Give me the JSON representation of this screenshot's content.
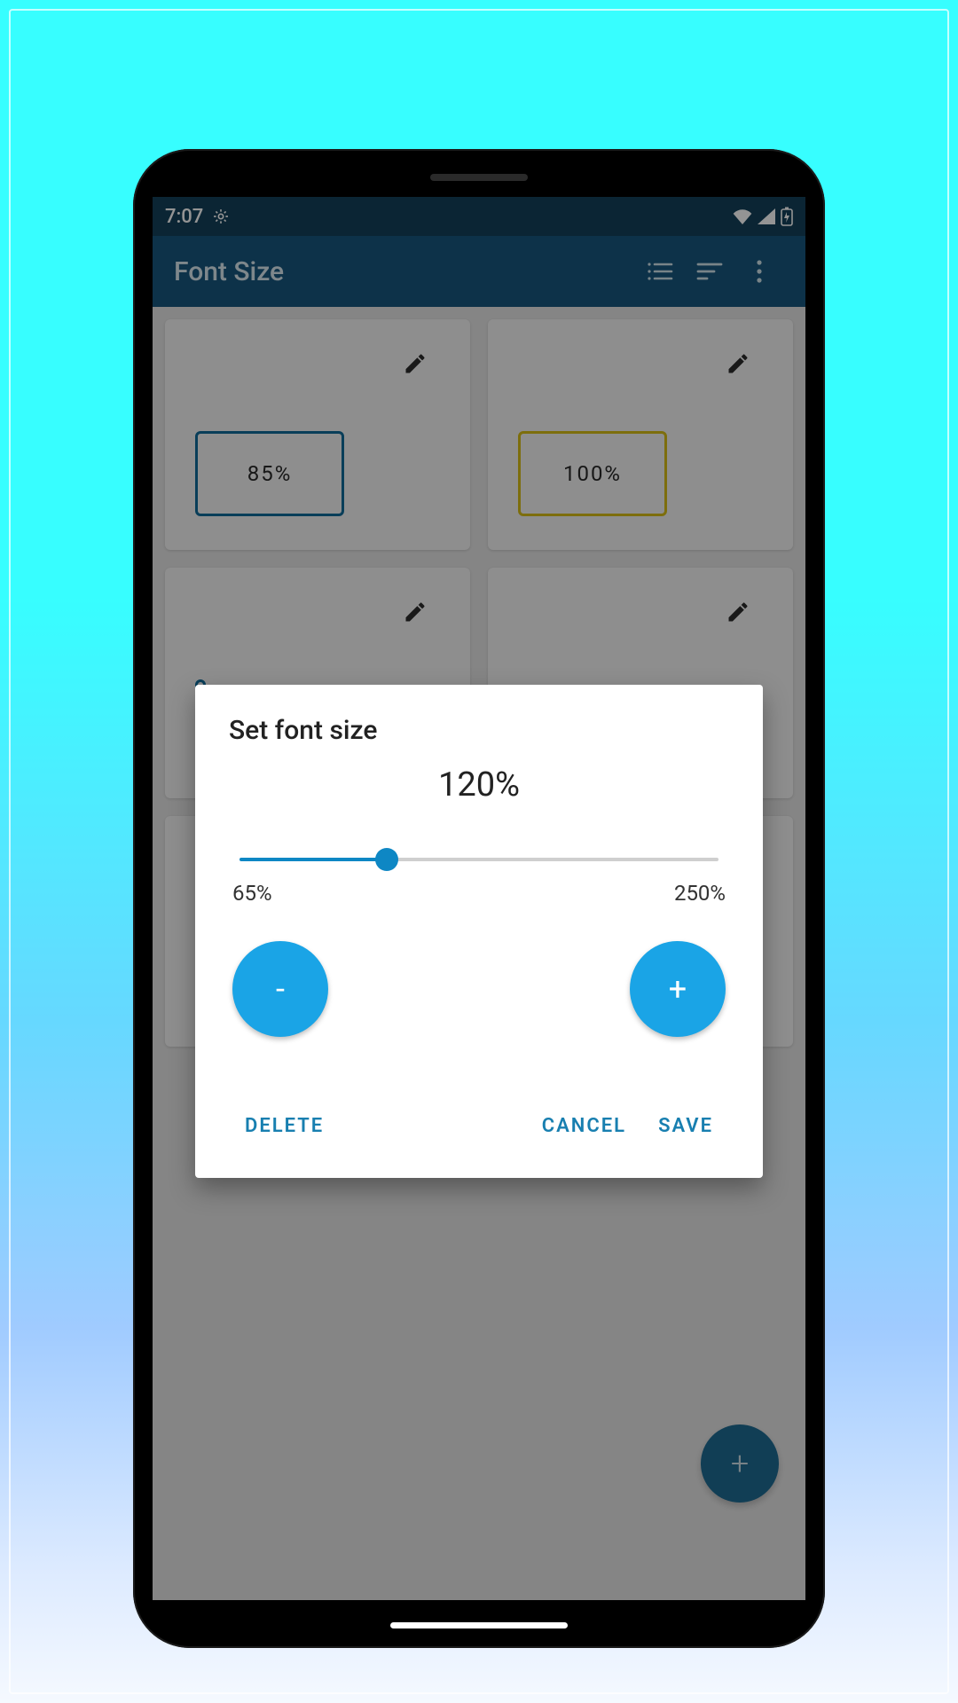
{
  "statusbar": {
    "time": "7:07"
  },
  "appbar": {
    "title": "Font Size"
  },
  "cards": [
    {
      "label": "85%",
      "badge_style": "blue"
    },
    {
      "label": "100%",
      "badge_style": "yellow"
    },
    {
      "label": "",
      "badge_style": "blue"
    },
    {
      "label": "",
      "badge_style": "none"
    },
    {
      "label": "",
      "badge_style": "blue"
    },
    {
      "label": "",
      "badge_style": "none"
    }
  ],
  "dialog": {
    "title": "Set font size",
    "value_label": "120%",
    "slider": {
      "min": 65,
      "max": 250,
      "value": 120
    },
    "min_label": "65%",
    "max_label": "250%",
    "decrement_label": "-",
    "increment_label": "+",
    "delete_label": "DELETE",
    "cancel_label": "CANCEL",
    "save_label": "SAVE"
  },
  "fab": {
    "label": "+"
  }
}
